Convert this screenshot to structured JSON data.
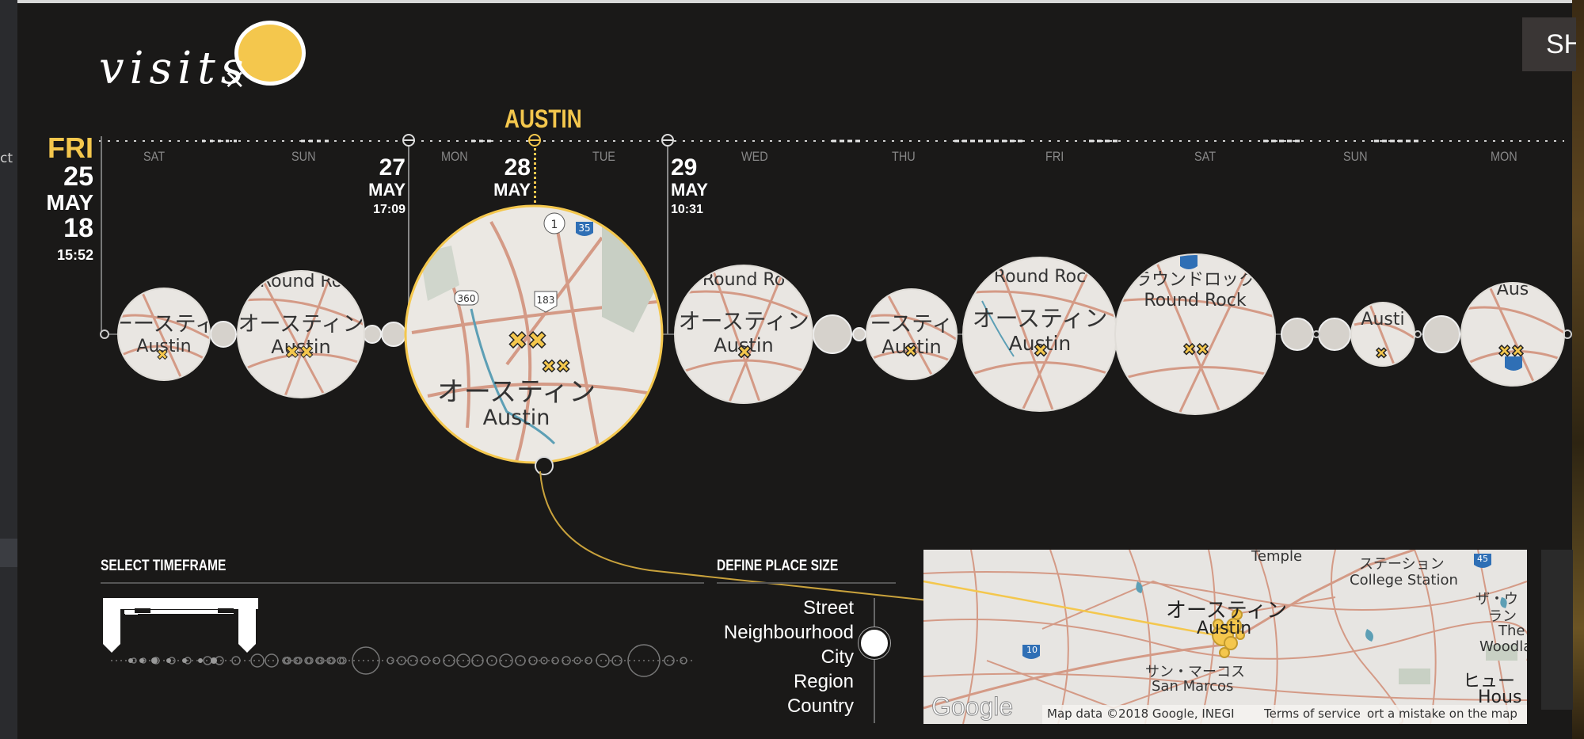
{
  "app": {
    "logo_text": "visits",
    "share_label": "SH",
    "left_cut_label": "ct"
  },
  "timeline": {
    "place_label": "AUSTIN",
    "day_labels": [
      "SAT",
      "SUN",
      "MON",
      "TUE",
      "WED",
      "THU",
      "FRI",
      "SAT",
      "SUN",
      "MON"
    ],
    "start": {
      "weekday": "FRI",
      "day": "25",
      "month": "MAY",
      "year": "18",
      "time": "15:52"
    },
    "markers": [
      {
        "day": "27",
        "month": "MAY",
        "time": "17:09"
      },
      {
        "day": "28",
        "month": "MAY",
        "time": ""
      },
      {
        "day": "29",
        "month": "MAY",
        "time": "10:31"
      }
    ],
    "bubbles": [
      {
        "city_jp": "ーースティ",
        "city_en": "Austin"
      },
      {
        "city_jp": "オースティン",
        "city_en": "Austin",
        "top": "Round Ro"
      },
      {
        "city_jp": "オースティン",
        "city_en": "Austin",
        "selected": true
      },
      {
        "city_jp": "オースティン",
        "city_en": "Austin",
        "top": "Round Ro"
      },
      {
        "city_jp": "ースティ",
        "city_en": "Austin"
      },
      {
        "city_jp": "オースティン",
        "city_en": "Austin",
        "top": "Round Roc"
      },
      {
        "city_jp": "ラウンドロック",
        "city_en": "Round Rock"
      },
      {
        "city_jp": "",
        "city_en": "Austi"
      },
      {
        "city_jp": "",
        "city_en": "Aus"
      }
    ],
    "road_labels": [
      "1",
      "35",
      "360",
      "183"
    ]
  },
  "controls": {
    "timeframe_title": "SELECT TIMEFRAME",
    "place_size_title": "DEFINE PLACE SIZE",
    "place_sizes": [
      "Street",
      "Neighbourhood",
      "City",
      "Region",
      "Country"
    ],
    "selected_size": "City"
  },
  "minimap": {
    "labels": {
      "temple": "Temple",
      "station_jp": "ステーション",
      "college_station": "College Station",
      "austin_jp": "オースティン",
      "austin": "Austin",
      "san_marcos_jp": "サン・マーコス",
      "san_marcos": "San Marcos",
      "the_woodlands_jp": "ザ・ウ",
      "the_woodlands_jp2": "ラン",
      "the": "The",
      "woodla": "Woodla",
      "houston_jp": "ヒュー",
      "hous": "Hous",
      "road_45": "45",
      "road_10": "10"
    },
    "google": "Google",
    "map_data": "Map data ©2018 Google, INEGI",
    "terms": "Terms of service",
    "report": "ort a mistake on the map"
  },
  "colors": {
    "accent": "#f4c74d",
    "background": "#1a1918",
    "map_land": "#e7e5e2",
    "map_road": "#d49a86"
  }
}
